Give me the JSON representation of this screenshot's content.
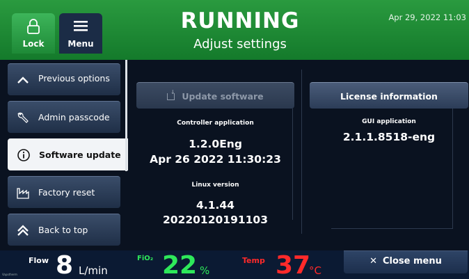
{
  "header": {
    "lock_label": "Lock",
    "menu_label": "Menu",
    "title": "RUNNING",
    "subtitle": "Adjust settings",
    "datetime": "Apr 29, 2022 11:03"
  },
  "sidebar": {
    "items": [
      {
        "label": "Previous options",
        "icon": "chevron-up-icon"
      },
      {
        "label": "Admin passcode",
        "icon": "wrench-icon"
      },
      {
        "label": "Software update",
        "icon": "info-icon",
        "active": true
      },
      {
        "label": "Factory reset",
        "icon": "factory-icon"
      },
      {
        "label": "Back to top",
        "icon": "double-chevron-up-icon"
      }
    ]
  },
  "main": {
    "update_button": "Update software",
    "license_button": "License information",
    "controller_label": "Controller application",
    "controller_version": "1.2.0Eng",
    "controller_date": "Apr 26 2022 11:30:23",
    "linux_label": "Linux version",
    "linux_version": "4.1.44",
    "linux_build": "20220120191103",
    "gui_label": "GUI application",
    "gui_version": "2.1.1.8518-eng"
  },
  "footer": {
    "flow_label": "Flow",
    "flow_value": "8",
    "flow_unit": "L/min",
    "fio2_label": "FiO₂",
    "fio2_value": "22",
    "fio2_unit": "%",
    "temp_label": "Temp",
    "temp_value": "37",
    "temp_unit": "°C",
    "close_label": "Close menu",
    "logo_text": "Vapotherm"
  },
  "colors": {
    "header_green": "#1e8a37",
    "fio2_green": "#2ee85a",
    "temp_red": "#ff2a2a"
  }
}
